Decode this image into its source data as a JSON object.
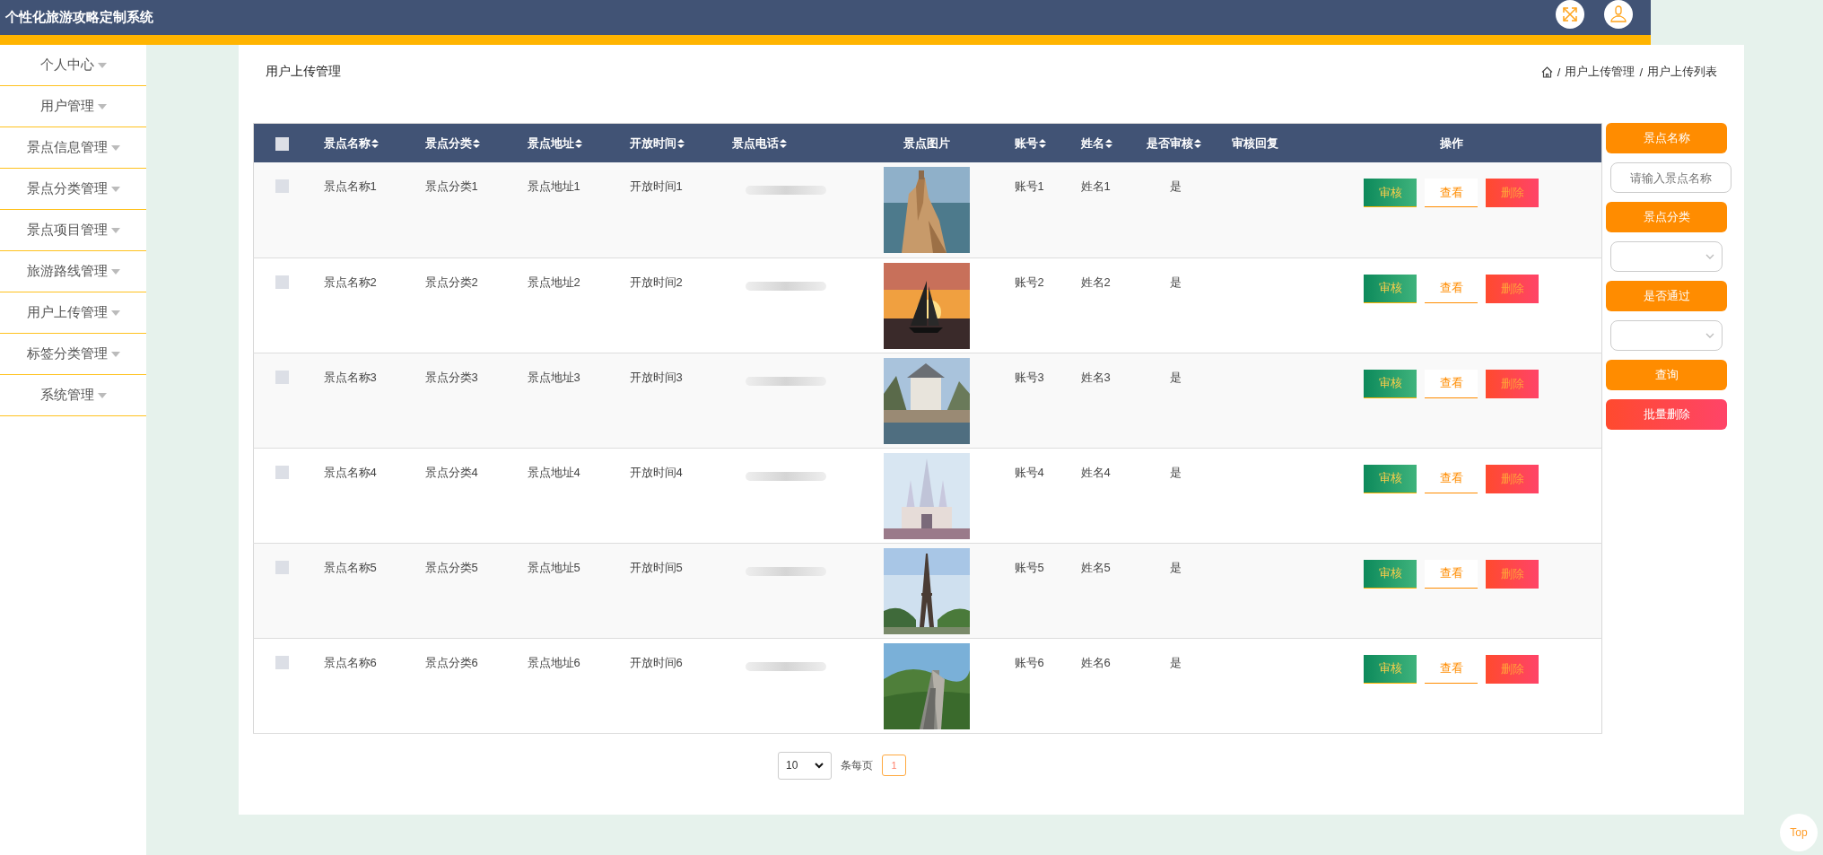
{
  "header": {
    "title": "个性化旅游攻略定制系统"
  },
  "sidebar": {
    "items": [
      {
        "label": "个人中心"
      },
      {
        "label": "用户管理"
      },
      {
        "label": "景点信息管理"
      },
      {
        "label": "景点分类管理"
      },
      {
        "label": "景点项目管理"
      },
      {
        "label": "旅游路线管理"
      },
      {
        "label": "用户上传管理"
      },
      {
        "label": "标签分类管理"
      },
      {
        "label": "系统管理"
      }
    ]
  },
  "page_title": "用户上传管理",
  "breadcrumb": {
    "separator": "/",
    "items": [
      "用户上传管理",
      "用户上传列表"
    ]
  },
  "table": {
    "select_all": {
      "checked": false
    },
    "columns": [
      {
        "label": "景点名称",
        "sortable": true
      },
      {
        "label": "景点分类",
        "sortable": true
      },
      {
        "label": "景点地址",
        "sortable": true
      },
      {
        "label": "开放时间",
        "sortable": true
      },
      {
        "label": "景点电话",
        "sortable": true
      },
      {
        "label": "景点图片",
        "sortable": false
      },
      {
        "label": "账号",
        "sortable": true
      },
      {
        "label": "姓名",
        "sortable": true
      },
      {
        "label": "是否审核",
        "sortable": true
      },
      {
        "label": "审核回复",
        "sortable": false
      },
      {
        "label": "操作",
        "sortable": false
      }
    ],
    "rows": [
      {
        "checked": false,
        "name": "景点名称1",
        "category": "景点分类1",
        "address": "景点地址1",
        "open_time": "开放时间1",
        "account": "账号1",
        "user_name": "姓名1",
        "approved": "是",
        "actions": [
          {
            "kind": "review",
            "label": "审核"
          },
          {
            "kind": "view",
            "label": "查看"
          },
          {
            "kind": "delete",
            "label": "删除"
          }
        ]
      },
      {
        "checked": false,
        "name": "景点名称2",
        "category": "景点分类2",
        "address": "景点地址2",
        "open_time": "开放时间2",
        "account": "账号2",
        "user_name": "姓名2",
        "approved": "是",
        "actions": [
          {
            "kind": "review",
            "label": "审核"
          },
          {
            "kind": "view",
            "label": "查看"
          },
          {
            "kind": "delete",
            "label": "删除"
          }
        ]
      },
      {
        "checked": false,
        "name": "景点名称3",
        "category": "景点分类3",
        "address": "景点地址3",
        "open_time": "开放时间3",
        "account": "账号3",
        "user_name": "姓名3",
        "approved": "是",
        "actions": [
          {
            "kind": "review",
            "label": "审核"
          },
          {
            "kind": "view",
            "label": "查看"
          },
          {
            "kind": "delete",
            "label": "删除"
          }
        ]
      },
      {
        "checked": false,
        "name": "景点名称4",
        "category": "景点分类4",
        "address": "景点地址4",
        "open_time": "开放时间4",
        "account": "账号4",
        "user_name": "姓名4",
        "approved": "是",
        "actions": [
          {
            "kind": "review",
            "label": "审核"
          },
          {
            "kind": "view",
            "label": "查看"
          },
          {
            "kind": "delete",
            "label": "删除"
          }
        ]
      },
      {
        "checked": false,
        "name": "景点名称5",
        "category": "景点分类5",
        "address": "景点地址5",
        "open_time": "开放时间5",
        "account": "账号5",
        "user_name": "姓名5",
        "approved": "是",
        "actions": [
          {
            "kind": "review",
            "label": "审核"
          },
          {
            "kind": "view",
            "label": "查看"
          },
          {
            "kind": "delete",
            "label": "删除"
          }
        ]
      },
      {
        "checked": false,
        "name": "景点名称6",
        "category": "景点分类6",
        "address": "景点地址6",
        "open_time": "开放时间6",
        "account": "账号6",
        "user_name": "姓名6",
        "approved": "是",
        "actions": [
          {
            "kind": "review",
            "label": "审核"
          },
          {
            "kind": "view",
            "label": "查看"
          },
          {
            "kind": "delete",
            "label": "删除"
          }
        ]
      }
    ]
  },
  "filters": [
    {
      "kind": "label",
      "text": "景点名称"
    },
    {
      "kind": "input",
      "placeholder": "请输入景点名称"
    },
    {
      "kind": "label",
      "text": "景点分类"
    },
    {
      "kind": "select"
    },
    {
      "kind": "label",
      "text": "是否通过"
    },
    {
      "kind": "select"
    },
    {
      "kind": "search",
      "text": "查询"
    },
    {
      "kind": "batch_delete",
      "text": "批量删除"
    }
  ],
  "pagination": {
    "page_size": "10",
    "per_page_label": "条每页",
    "pages": [
      {
        "label": "1",
        "selected": true
      }
    ]
  },
  "back_to_top": "Top"
}
